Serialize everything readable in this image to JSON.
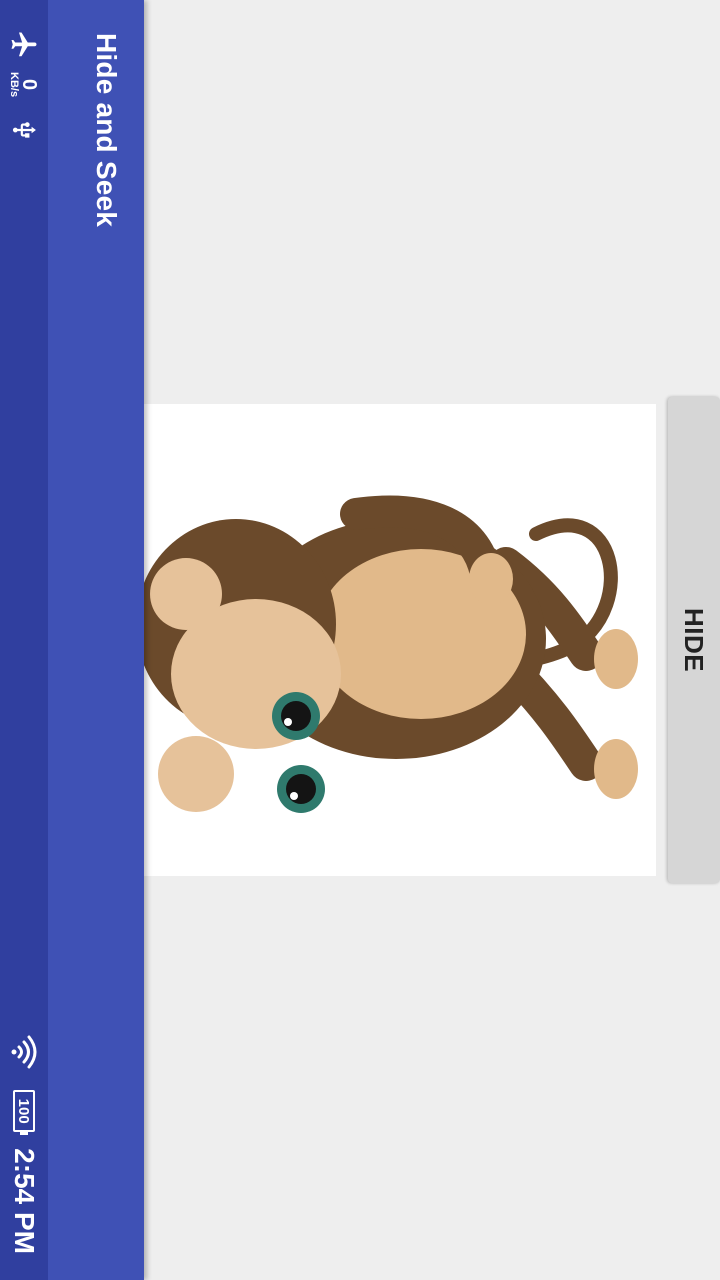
{
  "status_bar": {
    "network_speed_value": "0",
    "network_speed_unit": "KB/s",
    "battery_level": "100",
    "time": "2:54 PM",
    "icons": [
      "airplane-mode-icon",
      "usb-icon",
      "wifi-icon",
      "battery-icon"
    ]
  },
  "app_bar": {
    "title": "Hide and Seek",
    "color": "#3f51b5",
    "status_color": "#303f9f"
  },
  "content": {
    "image": "monkey-cartoon",
    "hide_button_label": "HIDE"
  }
}
